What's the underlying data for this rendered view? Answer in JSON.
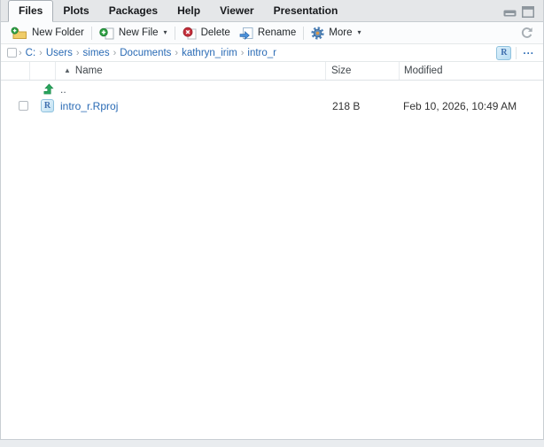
{
  "tabs": {
    "items": [
      {
        "label": "Files",
        "active": true
      },
      {
        "label": "Plots",
        "active": false
      },
      {
        "label": "Packages",
        "active": false
      },
      {
        "label": "Help",
        "active": false
      },
      {
        "label": "Viewer",
        "active": false
      },
      {
        "label": "Presentation",
        "active": false
      }
    ]
  },
  "toolbar": {
    "new_folder": "New Folder",
    "new_file": "New File",
    "delete": "Delete",
    "rename": "Rename",
    "more": "More",
    "caret": "▾"
  },
  "breadcrumb": {
    "separator": "›",
    "segments": [
      "C:",
      "Users",
      "simes",
      "Documents",
      "kathryn_irim",
      "intro_r"
    ],
    "more": "..."
  },
  "listing": {
    "header": {
      "sort_icon": "▲",
      "name": "Name",
      "size": "Size",
      "modified": "Modified"
    },
    "rows": [
      {
        "name": "..",
        "size": "",
        "modified": ""
      },
      {
        "name": "intro_r.Rproj",
        "size": "218 B",
        "modified": "Feb 10, 2026, 10:49 AM"
      }
    ]
  },
  "icons": {
    "r_project": "R"
  },
  "colors": {
    "link_blue": "#2a6bb5",
    "tabbar_bg": "#e5e7e9",
    "pane_border": "#c9ced3",
    "green": "#28a55c",
    "red": "#c5303c",
    "folder_yellow": "#efcb66",
    "gear_blue": "#4b80b8",
    "gear_hub_orange": "#d89a50",
    "icon_grey": "#8d969d"
  }
}
